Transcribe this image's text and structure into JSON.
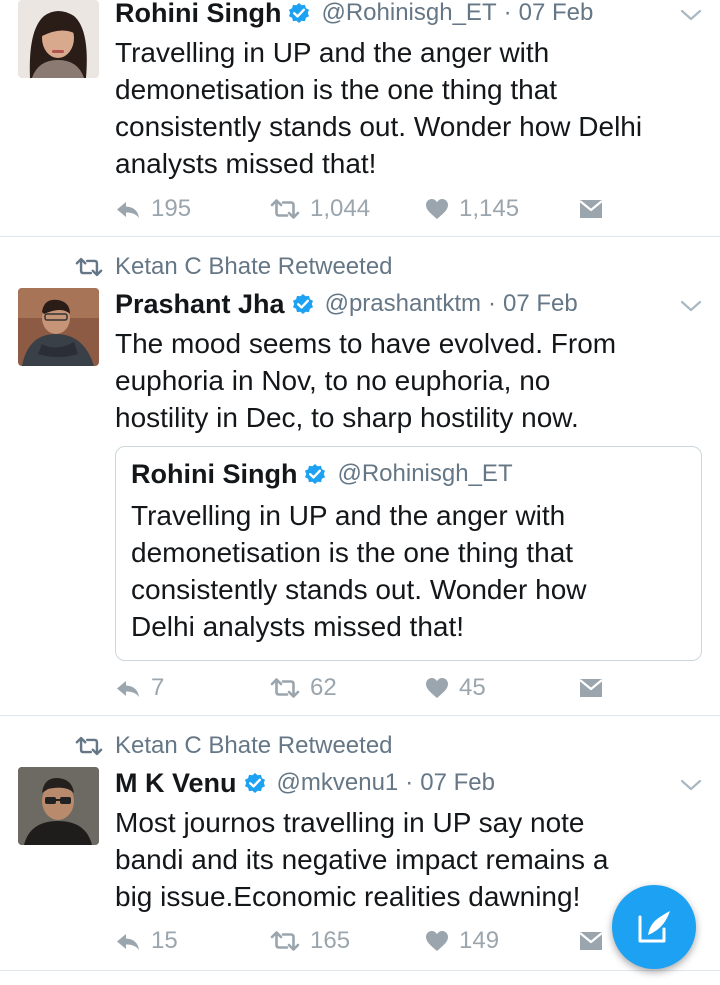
{
  "tweets": [
    {
      "author": {
        "name": "Rohini Singh",
        "handle": "@Rohinisgh_ET",
        "verified": true
      },
      "date": "07 Feb",
      "text_lines": [
        "Travelling in UP and the anger with",
        "demonetisation is the one thing that",
        "consistently stands out. Wonder how Delhi",
        "analysts missed that!"
      ],
      "replies": "195",
      "retweets": "1,044",
      "likes": "1,145"
    },
    {
      "retweeted_by": "Ketan C Bhate Retweeted",
      "author": {
        "name": "Prashant Jha",
        "handle": "@prashantktm",
        "verified": true
      },
      "date": "07 Feb",
      "text_lines": [
        "The mood seems to have evolved. From",
        "euphoria in Nov, to no euphoria, no",
        "hostility in Dec, to sharp hostility now."
      ],
      "quoted": {
        "author": {
          "name": "Rohini Singh",
          "handle": "@Rohinisgh_ET",
          "verified": true
        },
        "text_lines": [
          "Travelling in UP and the anger with",
          "demonetisation is the one thing that",
          "consistently stands out. Wonder how",
          "Delhi analysts missed that!"
        ]
      },
      "replies": "7",
      "retweets": "62",
      "likes": "45"
    },
    {
      "retweeted_by": "Ketan C Bhate Retweeted",
      "author": {
        "name": "M K Venu",
        "handle": "@mkvenu1",
        "verified": true
      },
      "date": "07 Feb",
      "text_lines": [
        "Most journos travelling in UP say note",
        "bandi and its negative impact remains a",
        "big issue.Economic realities dawning!"
      ],
      "replies": "15",
      "retweets": "165",
      "likes": "149"
    }
  ],
  "separator": "·",
  "colors": {
    "accent": "#1da1f2",
    "verified": "#1da1f2",
    "muted": "#657786",
    "action": "#9aa5ad"
  },
  "icons": [
    "verified-badge-icon",
    "chevron-down-icon",
    "reply-icon",
    "retweet-icon",
    "heart-icon",
    "message-icon",
    "compose-icon"
  ]
}
